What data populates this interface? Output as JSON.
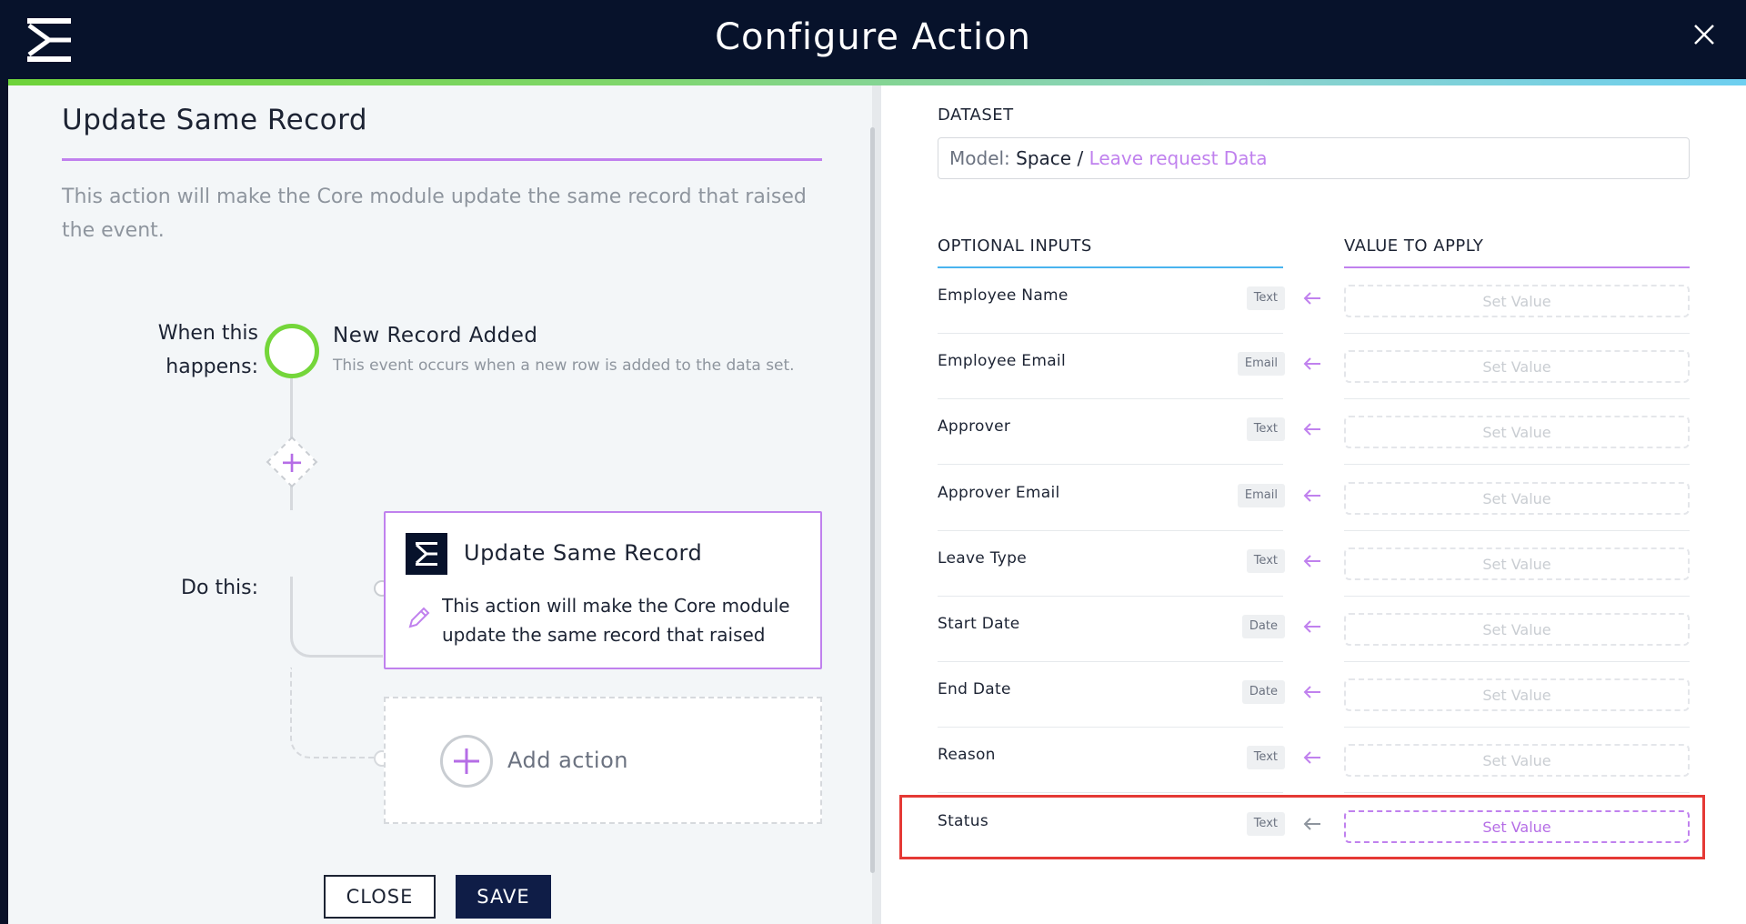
{
  "header": {
    "title": "Configure Action"
  },
  "left": {
    "title": "Update Same Record",
    "description": "This action will make the Core module update the same record that raised the event.",
    "when_label": "When this happens:",
    "do_label": "Do this:",
    "event": {
      "title": "New Record Added",
      "description": "This event occurs when a new row is added to the data set."
    },
    "card": {
      "title": "Update Same Record",
      "description": "This action will make the Core module update the same record that raised th…"
    },
    "add_action_label": "Add action",
    "buttons": {
      "close": "CLOSE",
      "save": "SAVE"
    }
  },
  "right": {
    "dataset_label": "DATASET",
    "dataset": {
      "key": "Model:",
      "model": "Space",
      "sep": " / ",
      "link": "Leave request Data"
    },
    "col_inputs": "OPTIONAL INPUTS",
    "col_values": "VALUE TO APPLY",
    "rows": [
      {
        "name": "Employee Name",
        "type": "Text",
        "value": "Set Value"
      },
      {
        "name": "Employee Email",
        "type": "Email",
        "value": "Set Value"
      },
      {
        "name": "Approver",
        "type": "Text",
        "value": "Set Value"
      },
      {
        "name": "Approver Email",
        "type": "Email",
        "value": "Set Value"
      },
      {
        "name": "Leave Type",
        "type": "Text",
        "value": "Set Value"
      },
      {
        "name": "Start Date",
        "type": "Date",
        "value": "Set Value"
      },
      {
        "name": "End Date",
        "type": "Date",
        "value": "Set Value"
      },
      {
        "name": "Reason",
        "type": "Text",
        "value": "Set Value"
      },
      {
        "name": "Status",
        "type": "Text",
        "value": "Set Value"
      }
    ]
  },
  "colors": {
    "accent": "#c081ee",
    "success": "#74d63a",
    "header": "#07122b",
    "save": "#0f1d47",
    "highlight": "#e53935"
  },
  "icons": [
    "app-logo-icon",
    "close-icon",
    "plus-icon",
    "pencil-icon",
    "arrow-left-icon"
  ]
}
